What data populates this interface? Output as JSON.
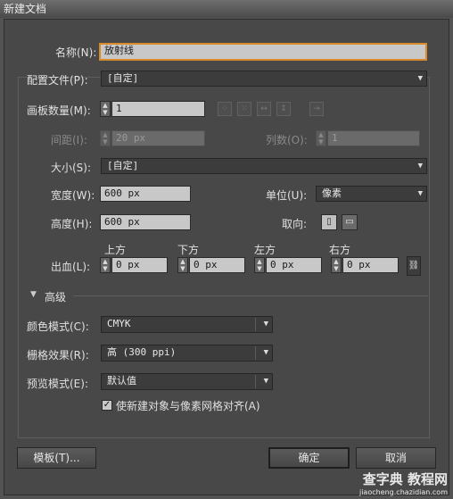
{
  "window": {
    "title": "新建文档"
  },
  "name": {
    "label": "名称(N):",
    "value": "放射线"
  },
  "profile": {
    "label": "配置文件(P):",
    "value": "[自定]"
  },
  "artboards": {
    "label": "画板数量(M):",
    "value": "1"
  },
  "spacing": {
    "label": "间距(I):",
    "value": "20 px"
  },
  "columns": {
    "label": "列数(O):",
    "value": "1"
  },
  "size": {
    "label": "大小(S):",
    "value": "[自定]"
  },
  "width": {
    "label": "宽度(W):",
    "value": "600 px"
  },
  "units": {
    "label": "单位(U):",
    "value": "像素"
  },
  "height": {
    "label": "高度(H):",
    "value": "600 px"
  },
  "orientation": {
    "label": "取向:"
  },
  "bleed": {
    "label": "出血(L):",
    "top": {
      "label": "上方",
      "value": "0 px"
    },
    "bottom": {
      "label": "下方",
      "value": "0 px"
    },
    "left": {
      "label": "左方",
      "value": "0 px"
    },
    "right": {
      "label": "右方",
      "value": "0 px"
    }
  },
  "advanced": {
    "label": "高级"
  },
  "color_mode": {
    "label": "颜色模式(C):",
    "value": "CMYK"
  },
  "raster": {
    "label": "栅格效果(R):",
    "value": "高 (300 ppi)"
  },
  "preview": {
    "label": "预览模式(E):",
    "value": "默认值"
  },
  "align": {
    "label": "使新建对象与像素网格对齐(A)",
    "checked": true,
    "mark": "✓"
  },
  "buttons": {
    "templates": "模板(T)...",
    "ok": "确定",
    "cancel": "取消"
  },
  "watermark": {
    "line1": "查字典 教程网",
    "line2": "jiaocheng.chazidian.com"
  },
  "colors": {
    "focus_border": "#d88a2a",
    "dialog_bg": "#484848"
  }
}
